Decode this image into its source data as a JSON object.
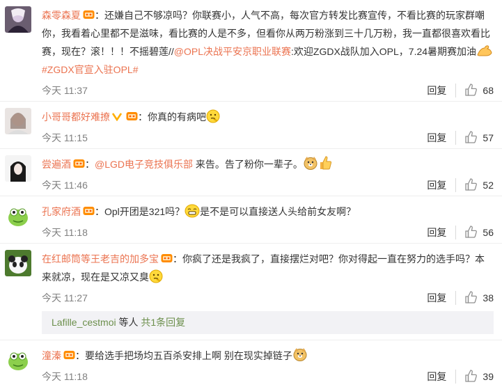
{
  "comments": [
    {
      "user": "森零森夏",
      "text_parts": [
        {
          "t": "plain",
          "v": "：还嫌自己不够凉吗？你联赛小，人气不高，每次官方转发比赛宣传，不看比赛的玩家群嘲你，我看着心里都不是滋味，看比赛的人是不多，但看你从两万粉涨到三十几万粉，我一直都很喜欢看比赛，现在？滚！！！不摇碧莲//"
        },
        {
          "t": "mention",
          "v": "@OPL决战平安京职业联赛"
        },
        {
          "t": "plain",
          "v": ":欢迎ZGDX战队加入OPL，7.24暑期赛加油"
        },
        {
          "t": "emoji",
          "v": "muscle"
        },
        {
          "t": "topic",
          "v": "#ZGDX官宣入驻OPL#"
        }
      ],
      "time": "今天 11:37",
      "reply_label": "回复",
      "likes": "68"
    },
    {
      "user": "小哥哥都好难撩",
      "text_parts": [
        {
          "t": "plain",
          "v": "：你真的有病吧"
        },
        {
          "t": "emoji",
          "v": "thinking"
        }
      ],
      "time": "今天 11:15",
      "reply_label": "回复",
      "likes": "57"
    },
    {
      "user": "尝遍酒",
      "text_parts": [
        {
          "t": "plain",
          "v": "："
        },
        {
          "t": "mention",
          "v": "@LGD电子竞技俱乐部"
        },
        {
          "t": "plain",
          "v": " 来告。告了粉你一辈子。"
        },
        {
          "t": "emoji",
          "v": "doge"
        },
        {
          "t": "emoji",
          "v": "thumb"
        }
      ],
      "time": "今天 11:46",
      "reply_label": "回复",
      "likes": "52"
    },
    {
      "user": "孔家府酒",
      "text_parts": [
        {
          "t": "plain",
          "v": "：Opl开团是321吗？"
        },
        {
          "t": "emoji",
          "v": "grin"
        },
        {
          "t": "plain",
          "v": "是不是可以直接送人头给前女友啊？"
        }
      ],
      "time": "今天 11:18",
      "reply_label": "回复",
      "likes": "56"
    },
    {
      "user": "在红邮筒等王老吉的加多宝",
      "text_parts": [
        {
          "t": "plain",
          "v": "：你疯了还是我疯了，直接摆烂对吧？你对得起一直在努力的选手吗？本来就凉，现在是又凉又臭"
        },
        {
          "t": "emoji",
          "v": "thinking"
        }
      ],
      "time": "今天 11:27",
      "reply_label": "回复",
      "likes": "38",
      "sub_reply": {
        "who": "Lafille_cestmoi",
        "mid": " 等人 ",
        "more": "共1条回复"
      }
    },
    {
      "user": "潼溱",
      "text_parts": [
        {
          "t": "plain",
          "v": "：要给选手把场均五百杀安排上啊 别在现实掉链子"
        },
        {
          "t": "emoji",
          "v": "doge"
        }
      ],
      "time": "今天 11:18",
      "reply_label": "回复",
      "likes": "39"
    }
  ],
  "colors": {
    "accent": "#eb7350",
    "time": "#808080",
    "subreply_bg": "#f2f2f5",
    "subreply_link": "#6c8f4c"
  }
}
